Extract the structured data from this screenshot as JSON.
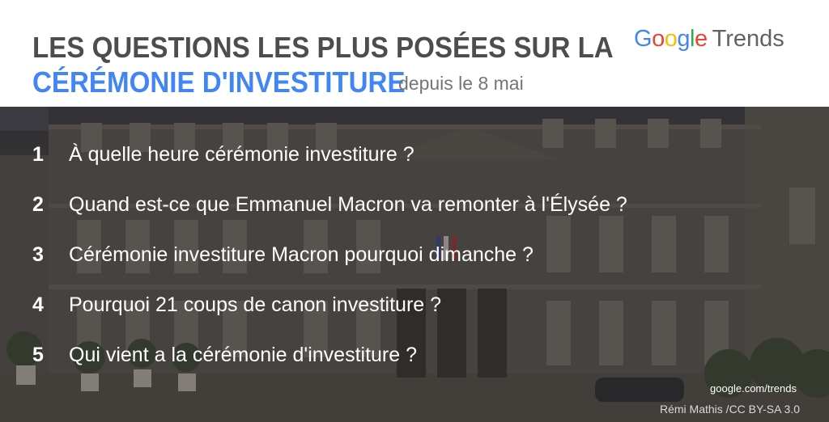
{
  "header": {
    "title_line1": "LES QUESTIONS LES PLUS POSÉES SUR LA",
    "title_line2": "CÉRÉMONIE D'INVESTITURE",
    "subtitle": "depuis le 8 mai",
    "logo": {
      "letters": [
        "G",
        "o",
        "o",
        "g",
        "l",
        "e"
      ],
      "trends": "Trends"
    }
  },
  "questions": [
    {
      "rank": "1",
      "text": "À quelle heure cérémonie investiture ?"
    },
    {
      "rank": "2",
      "text": "Quand est-ce que Emmanuel Macron va remonter à l'Élysée ?"
    },
    {
      "rank": "3",
      "text": "Cérémonie investiture Macron pourquoi dimanche ?"
    },
    {
      "rank": "4",
      "text": "Pourquoi 21 coups de canon investiture ?"
    },
    {
      "rank": "5",
      "text": "Qui vient a la cérémonie d'investiture ?"
    }
  ],
  "footer": {
    "source": "google.com/trends",
    "credit": "Rémi Mathis /CC BY-SA 3.0"
  },
  "colors": {
    "title_gray": "#4d4d4d",
    "title_blue": "#4285f4",
    "subtitle_gray": "#757575",
    "google_blue": "#4285f4",
    "google_red": "#ea4335",
    "google_yellow": "#fbbc05",
    "google_green": "#34a853"
  },
  "background_image": "palace-facade-photo"
}
